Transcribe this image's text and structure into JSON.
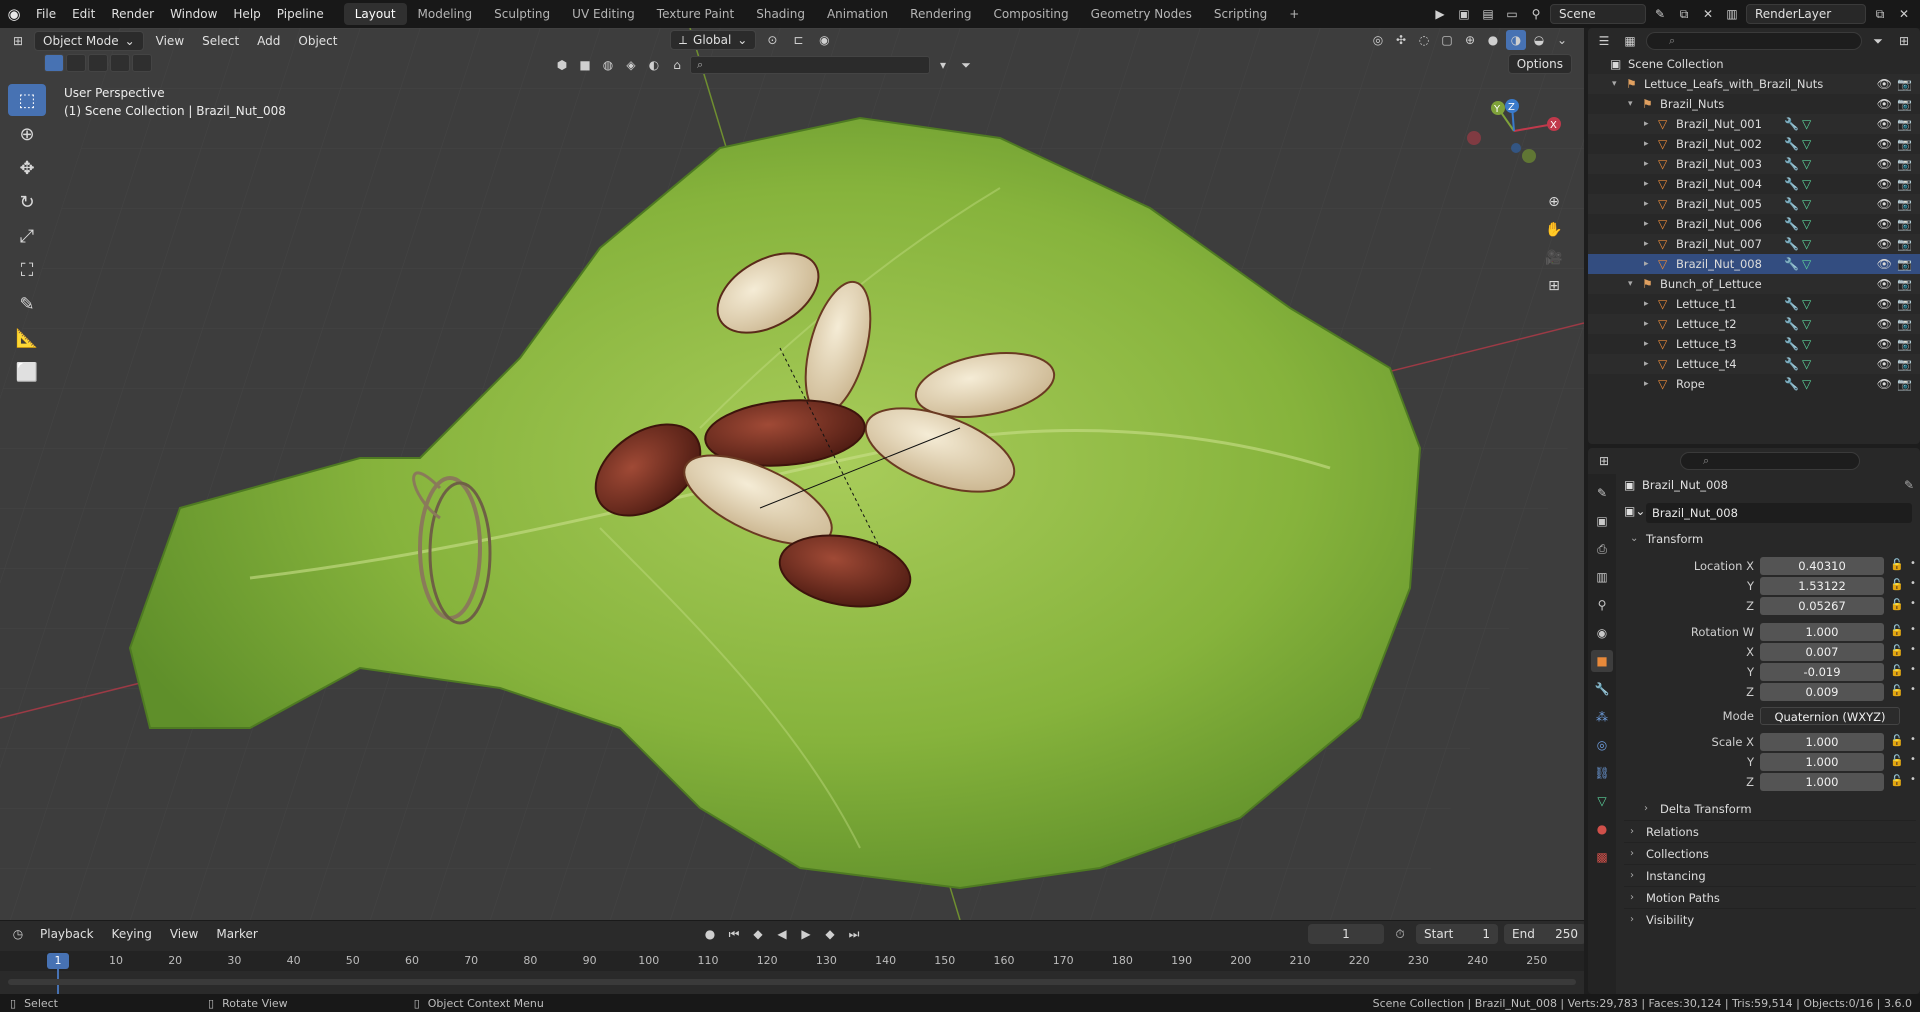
{
  "topbar": {
    "menus": [
      "File",
      "Edit",
      "Render",
      "Window",
      "Help",
      "Pipeline"
    ],
    "workspaces": [
      "Layout",
      "Modeling",
      "Sculpting",
      "UV Editing",
      "Texture Paint",
      "Shading",
      "Animation",
      "Rendering",
      "Compositing",
      "Geometry Nodes",
      "Scripting"
    ],
    "active_workspace": "Layout",
    "add_tab": "+",
    "scene_name": "Scene",
    "view_layer": "RenderLayer"
  },
  "viewport": {
    "mode": "Object Mode",
    "menus": [
      "View",
      "Select",
      "Add",
      "Object"
    ],
    "transform_orientation": "Global",
    "options_label": "Options",
    "overlay_line1": "User Perspective",
    "overlay_line2": "(1) Scene Collection | Brazil_Nut_008",
    "gizmo_axes": {
      "x": "X",
      "y": "Y",
      "z": "Z"
    },
    "filter_placeholder": ""
  },
  "outliner": {
    "search_placeholder": "",
    "rows": [
      {
        "label": "Scene Collection",
        "type": "scene"
      },
      {
        "label": "Lettuce_Leafs_with_Brazil_Nuts",
        "type": "collection"
      },
      {
        "label": "Brazil_Nuts",
        "type": "collection"
      },
      {
        "label": "Brazil_Nut_001",
        "type": "object"
      },
      {
        "label": "Brazil_Nut_002",
        "type": "object"
      },
      {
        "label": "Brazil_Nut_003",
        "type": "object"
      },
      {
        "label": "Brazil_Nut_004",
        "type": "object"
      },
      {
        "label": "Brazil_Nut_005",
        "type": "object"
      },
      {
        "label": "Brazil_Nut_006",
        "type": "object"
      },
      {
        "label": "Brazil_Nut_007",
        "type": "object"
      },
      {
        "label": "Brazil_Nut_008",
        "type": "object",
        "selected": true
      },
      {
        "label": "Bunch_of_Lettuce",
        "type": "collection"
      },
      {
        "label": "Lettuce_t1",
        "type": "object"
      },
      {
        "label": "Lettuce_t2",
        "type": "object"
      },
      {
        "label": "Lettuce_t3",
        "type": "object"
      },
      {
        "label": "Lettuce_t4",
        "type": "object"
      },
      {
        "label": "Rope",
        "type": "object"
      }
    ]
  },
  "properties": {
    "header_object": "Brazil_Nut_008",
    "object_name": "Brazil_Nut_008",
    "transform_title": "Transform",
    "location": {
      "label": "Location X",
      "x": "0.40310",
      "y": "1.53122",
      "z": "0.05267"
    },
    "rotation": {
      "label": "Rotation W",
      "w": "1.000",
      "x": "0.007",
      "y": "-0.019",
      "z": "0.009"
    },
    "axis_labels": {
      "x": "X",
      "y": "Y",
      "z": "Z"
    },
    "mode_label": "Mode",
    "mode_value": "Quaternion (WXYZ)",
    "scale": {
      "label": "Scale X",
      "x": "1.000",
      "y": "1.000",
      "z": "1.000"
    },
    "delta_transform": "Delta Transform",
    "sections": [
      "Relations",
      "Collections",
      "Instancing",
      "Motion Paths",
      "Visibility"
    ]
  },
  "timeline": {
    "menus": [
      "Playback",
      "Keying",
      "View",
      "Marker"
    ],
    "current_frame": "1",
    "start_label": "Start",
    "start_value": "1",
    "end_label": "End",
    "end_value": "250",
    "ruler": [
      "1",
      "10",
      "20",
      "30",
      "40",
      "50",
      "60",
      "70",
      "80",
      "90",
      "100",
      "110",
      "120",
      "130",
      "140",
      "150",
      "160",
      "170",
      "180",
      "190",
      "200",
      "210",
      "220",
      "230",
      "240",
      "250"
    ]
  },
  "statusbar": {
    "select": "Select",
    "rotate": "Rotate View",
    "context": "Object Context Menu",
    "stats": "Scene Collection | Brazil_Nut_008 | Verts:29,783 | Faces:30,124 | Tris:59,514 | Objects:0/16 | 3.6.0"
  },
  "colors": {
    "accent": "#4772b3",
    "viewport_bg": "#3d3d3d",
    "lettuce": "#8cb83a",
    "nut_dark": "#6b2a1c",
    "nut_light": "#e8dcc0",
    "axis_red": "#c0394b",
    "axis_green": "#7fa23a"
  }
}
